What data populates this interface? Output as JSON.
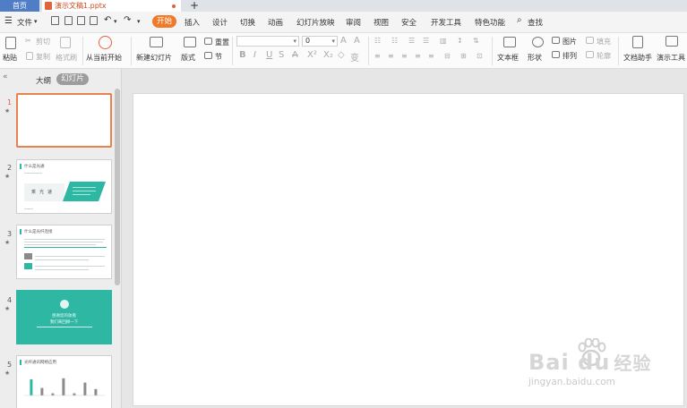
{
  "tabs": {
    "home": "首页",
    "document": "演示文稿1.pptx",
    "new_tab": "+"
  },
  "menu": {
    "file": "文件",
    "start": "开始",
    "items": [
      "插入",
      "设计",
      "切换",
      "动画",
      "幻灯片放映",
      "审阅",
      "视图",
      "安全",
      "开发工具",
      "特色功能"
    ],
    "search": "查找"
  },
  "ribbon": {
    "paste": "粘贴",
    "cut": "剪切",
    "copy": "复制",
    "format_painter": "格式刷",
    "from_current": "从当前开始",
    "new_slide": "新建幻灯片",
    "layout": "版式",
    "reset": "重置",
    "section": "节",
    "font_size": "0",
    "textbox": "文本框",
    "shape": "形状",
    "picture": "图片",
    "arrange": "排列",
    "fill": "填充",
    "outline": "轮廓",
    "doc_helper": "文档助手",
    "present_tools": "演示工具"
  },
  "panel": {
    "outline": "大纲",
    "slides": "幻灯片",
    "collapse": "«"
  },
  "slides": [
    {
      "num": "1"
    },
    {
      "num": "2",
      "title": "什么是光通",
      "labels": [
        "乘",
        "光",
        "速"
      ]
    },
    {
      "num": "3",
      "title": "什么是光纤连接"
    },
    {
      "num": "4",
      "text": [
        "感谢您的收看",
        "我们来回顾一下"
      ]
    },
    {
      "num": "5",
      "title": "光纤通讯网络应用",
      "chart_values": [
        0.75,
        0.35,
        0.1,
        0.8,
        0.1,
        0.6,
        0.3
      ]
    }
  ],
  "watermark": {
    "brand": "Bai  du",
    "brand_cn": "经验",
    "url": "jingyan.baidu.com"
  },
  "colors": {
    "accent": "#ef7a2a",
    "teal": "#2eb7a3",
    "selected_border": "#e8834f",
    "home_tab": "#4f7ec7"
  }
}
